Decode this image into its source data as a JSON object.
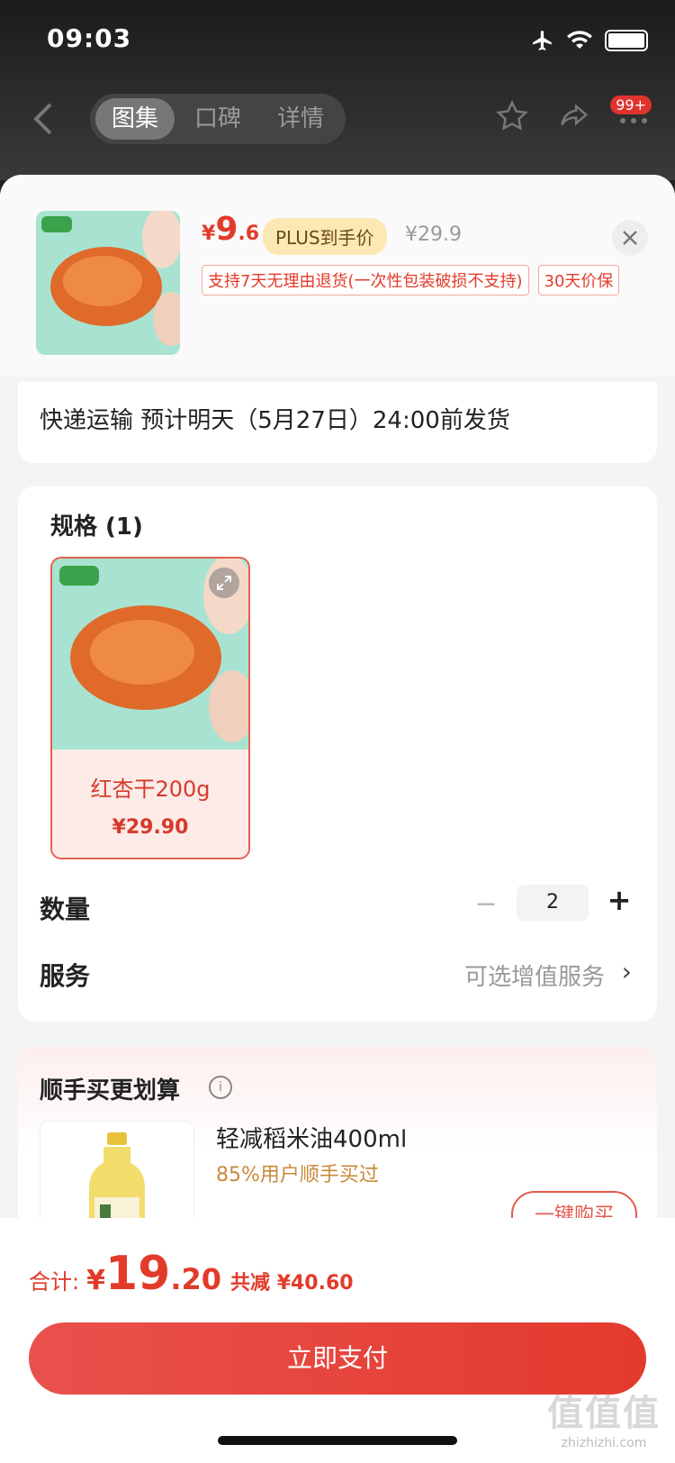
{
  "status": {
    "time": "09:03"
  },
  "nav": {
    "tabs": [
      "图集",
      "口碑",
      "详情"
    ],
    "badge": "99+"
  },
  "product": {
    "price_yen": "¥",
    "price_int": "9",
    "price_dec": ".6",
    "plus_tag": "PLUS到手价",
    "original_price": "¥29.9",
    "tags": [
      "支持7天无理由退货(一次性包装破损不支持)",
      "30天价保"
    ]
  },
  "shipping": {
    "text": "快递运输 预计明天（5月27日）24:00前发货"
  },
  "spec": {
    "title": "规格 (1)",
    "item": {
      "name": "红杏干200g",
      "price": "¥29.90"
    }
  },
  "quantity": {
    "label": "数量",
    "minus": "−",
    "value": "2",
    "plus": "+"
  },
  "service": {
    "label": "服务",
    "value": "可选增值服务",
    "chevron": "›"
  },
  "addon": {
    "title": "顺手买更划算",
    "info": "i",
    "product_name": "轻减稻米油400ml",
    "stat": "85%用户顺手买过",
    "button": "一键购买"
  },
  "footer": {
    "total_label": "合计:",
    "total_yen": "¥",
    "total_int": "19",
    "total_dec": ".20",
    "saving": "共减 ¥40.60",
    "pay_button": "立即支付"
  },
  "watermark": {
    "big": "值值值",
    "small": "zhizhizhi.com"
  },
  "colors": {
    "accent": "#e23b2a",
    "plus_bg": "#fbe8b4",
    "addon_stat": "#c9893c"
  },
  "icons": [
    "airplane-icon",
    "wifi-icon",
    "battery-icon",
    "back-icon",
    "star-icon",
    "share-icon",
    "more-icon",
    "close-icon",
    "expand-icon",
    "info-icon"
  ]
}
